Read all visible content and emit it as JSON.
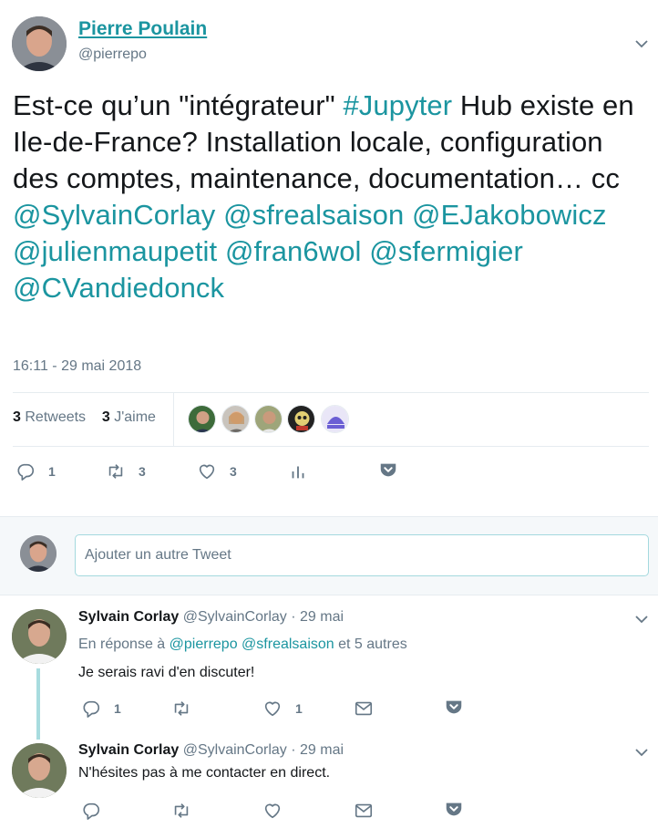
{
  "tweet": {
    "author_name": "Pierre Poulain",
    "author_handle": "@pierrepo",
    "text_parts": {
      "p1": "Est-ce qu’un \"intégrateur\" ",
      "hashtag": "#Jupyter",
      "p2": " Hub existe en Ile-de-France? Installation locale, configuration des comptes, maintenance, documentation… cc ",
      "m1": "@SylvainCorlay",
      "m2": "@sfrealsaison",
      "m3": "@EJakobowicz",
      "m4": "@julienmaupetit",
      "m5": "@fran6wol",
      "m6": "@sfermigier",
      "m7": "@CVandiedonck"
    },
    "timestamp": "16:11 - 29 mai 2018",
    "retweets_count": "3",
    "retweets_label": "Retweets",
    "likes_count": "3",
    "likes_label": "J'aime",
    "actions": {
      "reply_count": "1",
      "retweet_count": "3",
      "like_count": "3"
    }
  },
  "reply_box": {
    "placeholder": "Ajouter un autre Tweet"
  },
  "replies": [
    {
      "name": "Sylvain Corlay",
      "handle": "@SylvainCorlay",
      "date": "· 29 mai",
      "context_prefix": "En réponse à",
      "context_mention1": "@pierrepo",
      "context_mention2": "@sfrealsaison",
      "context_suffix": "et 5 autres",
      "text": "Je serais ravi d'en discuter!",
      "reply_count": "1",
      "like_count": "1"
    },
    {
      "name": "Sylvain Corlay",
      "handle": "@SylvainCorlay",
      "date": "· 29 mai",
      "text": "N'hésites pas à me contacter en direct."
    }
  ],
  "colors": {
    "accent": "#1b95a0",
    "muted": "#657786",
    "text": "#14171a",
    "border": "#e6ecf0"
  },
  "icons": [
    "chevron-down-icon",
    "reply-icon",
    "retweet-icon",
    "heart-icon",
    "analytics-icon",
    "pocket-icon",
    "mail-icon"
  ]
}
